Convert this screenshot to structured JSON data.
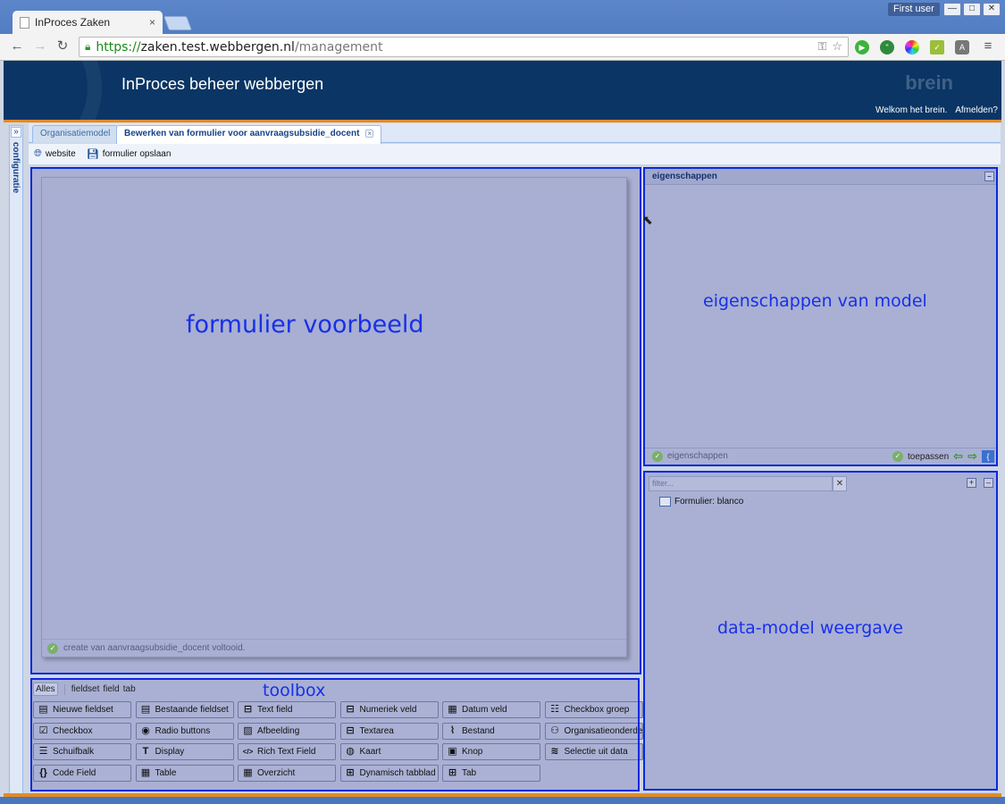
{
  "browser": {
    "tab_title": "InProces Zaken",
    "tab_close": "×",
    "user_badge": "First user",
    "win_min": "—",
    "win_max": "□",
    "win_close": "✕",
    "url_scheme": "https://",
    "url_host": "zaken.test.webbergen.nl",
    "url_path": "/management"
  },
  "app": {
    "title": "InProces beheer webbergen",
    "brand": "brein",
    "welcome": "Welkom het brein.",
    "logout": "Afmelden?"
  },
  "side_panel": {
    "label": "configuratie",
    "expand": "»"
  },
  "tabs": [
    {
      "label": "Organisatiemodel"
    },
    {
      "label": "Bewerken van formulier voor aanvraagsubsidie_docent"
    }
  ],
  "tab_close": "×",
  "toolbar": {
    "website": "website",
    "save": "formulier opslaan"
  },
  "form_preview": {
    "label": "formulier voorbeeld",
    "status": "create van aanvraagsubsidie_docent voltooid."
  },
  "properties": {
    "header": "eigenschappen",
    "label": "eigenschappen van model",
    "footer_status": "eigenschappen",
    "apply": "toepassen"
  },
  "datamodel": {
    "label": "data-model weergave",
    "filter_placeholder": "filter...",
    "filter_clear": "✕",
    "node": "Formulier: blanco"
  },
  "toolbox": {
    "label": "toolbox",
    "filters": [
      "Alles",
      "fieldset",
      "field",
      "tab"
    ],
    "rows": [
      [
        "Nieuwe fieldset",
        "Bestaande fieldset",
        "Text field",
        "Numeriek veld",
        "Datum veld",
        "Checkbox groep"
      ],
      [
        "Checkbox",
        "Radio buttons",
        "Afbeelding",
        "Textarea",
        "Bestand",
        "Organisatieonderdeel"
      ],
      [
        "Schuifbalk",
        "Display",
        "Rich Text Field",
        "Kaart",
        "Knop",
        "Selectie uit data"
      ],
      [
        "Code Field",
        "Table",
        "Overzicht",
        "Dynamisch tabblad",
        "Tab"
      ]
    ]
  }
}
